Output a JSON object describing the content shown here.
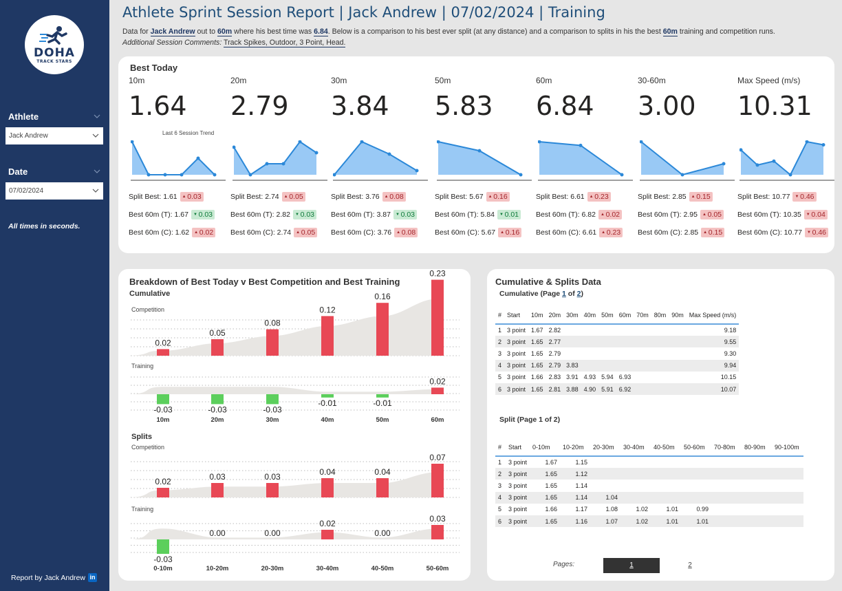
{
  "sidebar": {
    "logo_main": "DOHA",
    "logo_sub": "TRACK STARS",
    "athlete_label": "Athlete",
    "athlete_value": "Jack Andrew",
    "date_label": "Date",
    "date_value": "07/02/2024",
    "note": "All times in seconds.",
    "report_by": "Report by Jack Andrew",
    "linkedin": "in"
  },
  "header": {
    "title": "Athlete Sprint Session Report | Jack Andrew | 07/02/2024 | Training",
    "line1_pre": "Data for ",
    "athlete": "Jack Andrew",
    "line1_mid": " out to ",
    "distance": "60m",
    "line1_mid2": " where his best time was ",
    "best_time": "6.84",
    "line1_post": ". Below is a comparison to his best ever split (at any distance) and a comparison to splits in his the best ",
    "distance2": "60m",
    "line1_end": " training and competition runs.",
    "comments_label": "Additional Session Comments:",
    "comments": "Track Spikes, Outdoor, 3 Point, Head."
  },
  "best_today": {
    "title": "Best Today",
    "trend_label": "Last 6 Session Trend",
    "metrics": [
      {
        "label": "10m",
        "value": "1.64",
        "trend": [
          1.67,
          1.65,
          1.65,
          1.65,
          1.66,
          1.65
        ],
        "split_best": "Split Best: 1.61",
        "split_delta": "0.03",
        "split_dir": "up",
        "split_cls": "bad",
        "t_best": "Best 60m (T): 1.67",
        "t_delta": "0.03",
        "t_dir": "down",
        "t_cls": "good",
        "c_best": "Best 60m (C): 1.62",
        "c_delta": "0.02",
        "c_dir": "up",
        "c_cls": "bad"
      },
      {
        "label": "20m",
        "value": "2.79",
        "trend": [
          2.82,
          2.77,
          2.79,
          2.79,
          2.83,
          2.81
        ],
        "split_best": "Split Best: 2.74",
        "split_delta": "0.05",
        "split_dir": "up",
        "split_cls": "bad",
        "t_best": "Best 60m (T): 2.82",
        "t_delta": "0.03",
        "t_dir": "down",
        "t_cls": "good",
        "c_best": "Best 60m (C): 2.74",
        "c_delta": "0.05",
        "c_dir": "up",
        "c_cls": "bad"
      },
      {
        "label": "30m",
        "value": "3.84",
        "trend": [
          3.83,
          3.91,
          3.88,
          3.84
        ],
        "split_best": "Split Best: 3.76",
        "split_delta": "0.08",
        "split_dir": "up",
        "split_cls": "bad",
        "t_best": "Best 60m (T): 3.87",
        "t_delta": "0.03",
        "t_dir": "down",
        "t_cls": "good",
        "c_best": "Best 60m (C): 3.76",
        "c_delta": "0.08",
        "c_dir": "up",
        "c_cls": "bad"
      },
      {
        "label": "50m",
        "value": "5.83",
        "trend": [
          5.94,
          5.91,
          5.83
        ],
        "split_best": "Split Best: 5.67",
        "split_delta": "0.16",
        "split_dir": "up",
        "split_cls": "bad",
        "t_best": "Best 60m (T): 5.84",
        "t_delta": "0.01",
        "t_dir": "down",
        "t_cls": "good",
        "c_best": "Best 60m (C): 5.67",
        "c_delta": "0.16",
        "c_dir": "up",
        "c_cls": "bad"
      },
      {
        "label": "60m",
        "value": "6.84",
        "trend": [
          6.93,
          6.92,
          6.84
        ],
        "split_best": "Split Best: 6.61",
        "split_delta": "0.23",
        "split_dir": "up",
        "split_cls": "bad",
        "t_best": "Best 60m (T): 6.82",
        "t_delta": "0.02",
        "t_dir": "up",
        "t_cls": "bad",
        "c_best": "Best 60m (C): 6.61",
        "c_delta": "0.23",
        "c_dir": "up",
        "c_cls": "bad"
      },
      {
        "label": "30-60m",
        "value": "3.00",
        "trend": [
          3.02,
          2.99,
          3.0
        ],
        "split_best": "Split Best: 2.85",
        "split_delta": "0.15",
        "split_dir": "up",
        "split_cls": "bad",
        "t_best": "Best 60m (T): 2.95",
        "t_delta": "0.05",
        "t_dir": "up",
        "t_cls": "bad",
        "c_best": "Best 60m (C): 2.85",
        "c_delta": "0.15",
        "c_dir": "up",
        "c_cls": "bad"
      },
      {
        "label": "Max Speed (m/s)",
        "value": "10.31",
        "trend": [
          9.94,
          9.55,
          9.65,
          9.3,
          10.15,
          10.07
        ],
        "split_best": "Split Best: 10.77",
        "split_delta": "0.46",
        "split_dir": "down",
        "split_cls": "bad",
        "t_best": "Best 60m (T): 10.35",
        "t_delta": "0.04",
        "t_dir": "down",
        "t_cls": "bad",
        "c_best": "Best 60m (C): 10.77",
        "c_delta": "0.46",
        "c_dir": "down",
        "c_cls": "bad"
      }
    ]
  },
  "breakdown": {
    "title": "Breakdown of Best Today v Best Competition and Best Training",
    "cumulative_label": "Cumulative",
    "splits_label": "Splits",
    "competition_label": "Competition",
    "training_label": "Training",
    "cum_categories": [
      "10m",
      "20m",
      "30m",
      "40m",
      "50m",
      "60m"
    ],
    "split_categories": [
      "0-10m",
      "10-20m",
      "20-30m",
      "30-40m",
      "40-50m",
      "50-60m"
    ]
  },
  "chart_data": [
    {
      "type": "bar",
      "title": "Cumulative - Competition",
      "categories": [
        "10m",
        "20m",
        "30m",
        "40m",
        "50m",
        "60m"
      ],
      "values": [
        0.02,
        0.05,
        0.08,
        0.12,
        0.16,
        0.23
      ],
      "labels": [
        "0.02",
        "0.05",
        "0.08",
        "0.12",
        "0.16",
        "0.23"
      ]
    },
    {
      "type": "bar",
      "title": "Cumulative - Training",
      "categories": [
        "10m",
        "20m",
        "30m",
        "40m",
        "50m",
        "60m"
      ],
      "values": [
        -0.03,
        -0.03,
        -0.03,
        -0.01,
        -0.01,
        0.02
      ],
      "labels": [
        "-0.03",
        "-0.03",
        "-0.03",
        "-0.01",
        "-0.01",
        "0.02"
      ]
    },
    {
      "type": "bar",
      "title": "Splits - Competition",
      "categories": [
        "0-10m",
        "10-20m",
        "20-30m",
        "30-40m",
        "40-50m",
        "50-60m"
      ],
      "values": [
        0.02,
        0.03,
        0.03,
        0.04,
        0.04,
        0.07
      ],
      "labels": [
        "0.02",
        "0.03",
        "0.03",
        "0.04",
        "0.04",
        "0.07"
      ]
    },
    {
      "type": "bar",
      "title": "Splits - Training",
      "categories": [
        "0-10m",
        "10-20m",
        "20-30m",
        "30-40m",
        "40-50m",
        "50-60m"
      ],
      "values": [
        -0.03,
        0.0,
        0.0,
        0.02,
        0.0,
        0.03
      ],
      "labels": [
        "-0.03",
        "0.00",
        "0.00",
        "0.02",
        "0.00",
        "0.03"
      ]
    }
  ],
  "colors": {
    "positive": "#e84855",
    "negative": "#5ccf5c",
    "trend_line": "#2b88d8",
    "trend_fill": "#99c9f5",
    "nav": "#1f3864",
    "title": "#1f4e79"
  },
  "cum_splits": {
    "title": "Cumulative & Splits Data",
    "cum_sub_pre": "Cumulative (Page ",
    "cum_page": "1",
    "cum_sub_mid": " of ",
    "cum_pages": "2",
    "cum_sub_post": ")",
    "cum_headers": [
      "#",
      "Start",
      "10m",
      "20m",
      "30m",
      "40m",
      "50m",
      "60m",
      "70m",
      "80m",
      "90m",
      "Max Speed (m/s)"
    ],
    "cum_rows": [
      [
        "1",
        "3 point",
        "1.67",
        "2.82",
        "",
        "",
        "",
        "",
        "",
        "",
        "",
        "9.18"
      ],
      [
        "2",
        "3 point",
        "1.65",
        "2.77",
        "",
        "",
        "",
        "",
        "",
        "",
        "",
        "9.55"
      ],
      [
        "3",
        "3 point",
        "1.65",
        "2.79",
        "",
        "",
        "",
        "",
        "",
        "",
        "",
        "9.30"
      ],
      [
        "4",
        "3 point",
        "1.65",
        "2.79",
        "3.83",
        "",
        "",
        "",
        "",
        "",
        "",
        "9.94"
      ],
      [
        "5",
        "3 point",
        "1.66",
        "2.83",
        "3.91",
        "4.93",
        "5.94",
        "6.93",
        "",
        "",
        "",
        "10.15"
      ],
      [
        "6",
        "3 point",
        "1.65",
        "2.81",
        "3.88",
        "4.90",
        "5.91",
        "6.92",
        "",
        "",
        "",
        "10.07"
      ]
    ],
    "split_sub": "Split (Page 1 of 2)",
    "split_headers": [
      "#",
      "Start",
      "0-10m",
      "10-20m",
      "20-30m",
      "30-40m",
      "40-50m",
      "50-60m",
      "70-80m",
      "80-90m",
      "90-100m"
    ],
    "split_rows": [
      [
        "1",
        "3 point",
        "1.67",
        "1.15",
        "",
        "",
        "",
        "",
        "",
        "",
        ""
      ],
      [
        "2",
        "3 point",
        "1.65",
        "1.12",
        "",
        "",
        "",
        "",
        "",
        "",
        ""
      ],
      [
        "3",
        "3 point",
        "1.65",
        "1.14",
        "",
        "",
        "",
        "",
        "",
        "",
        ""
      ],
      [
        "4",
        "3 point",
        "1.65",
        "1.14",
        "1.04",
        "",
        "",
        "",
        "",
        "",
        ""
      ],
      [
        "5",
        "3 point",
        "1.66",
        "1.17",
        "1.08",
        "1.02",
        "1.01",
        "0.99",
        "",
        "",
        ""
      ],
      [
        "6",
        "3 point",
        "1.65",
        "1.16",
        "1.07",
        "1.02",
        "1.01",
        "1.01",
        "",
        "",
        ""
      ]
    ],
    "pages_label": "Pages:",
    "page1": "1",
    "page2": "2"
  }
}
